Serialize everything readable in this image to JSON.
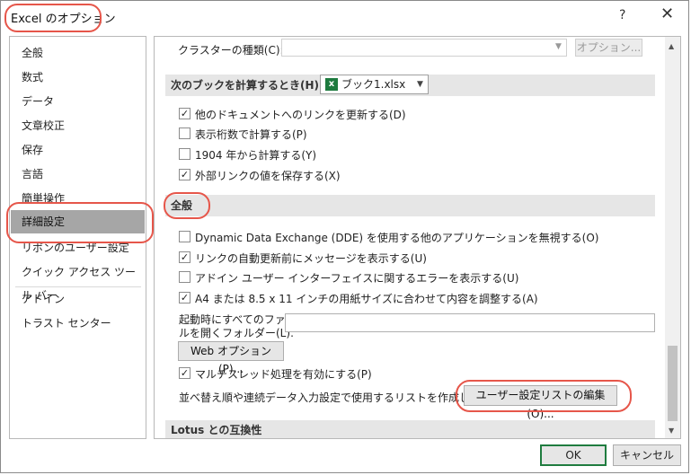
{
  "window": {
    "title": "Excel のオプション",
    "help": "?",
    "close": "✕"
  },
  "nav": {
    "items": [
      {
        "label": "全般"
      },
      {
        "label": "数式"
      },
      {
        "label": "データ"
      },
      {
        "label": "文章校正"
      },
      {
        "label": "保存"
      },
      {
        "label": "言語"
      },
      {
        "label": "簡単操作"
      },
      {
        "label": "詳細設定"
      },
      {
        "label": "リボンのユーザー設定"
      },
      {
        "label": "クイック アクセス ツール バー"
      },
      {
        "label": "アドイン"
      },
      {
        "label": "トラスト センター"
      }
    ],
    "selected": "詳細設定"
  },
  "cluster": {
    "label": "クラスターの種類(C):",
    "options_button": "オプション..."
  },
  "calc_section": {
    "header": "次のブックを計算するとき(H):",
    "workbook": "ブック1.xlsx",
    "options": [
      {
        "label": "他のドキュメントへのリンクを更新する(D)",
        "checked": "✓"
      },
      {
        "label": "表示桁数で計算する(P)",
        "checked": ""
      },
      {
        "label": "1904 年から計算する(Y)",
        "checked": ""
      },
      {
        "label": "外部リンクの値を保存する(X)",
        "checked": "✓"
      }
    ]
  },
  "general_section": {
    "header": "全般",
    "options": [
      {
        "label": "Dynamic Data Exchange (DDE) を使用する他のアプリケーションを無視する(O)",
        "checked": ""
      },
      {
        "label": "リンクの自動更新前にメッセージを表示する(U)",
        "checked": "✓"
      },
      {
        "label": "アドイン ユーザー インターフェイスに関するエラーを表示する(U)",
        "checked": ""
      },
      {
        "label": "A4 または 8.5 x 11 インチの用紙サイズに合わせて内容を調整する(A)",
        "checked": "✓"
      }
    ],
    "startup_label_1": "起動時にすべてのファイ",
    "startup_label_2": "ルを開くフォルダー(L):",
    "startup_value": "",
    "web_options_button": "Web オプション(P)...",
    "multithread": {
      "label": "マルチスレッド処理を有効にする(P)",
      "checked": "✓"
    },
    "sort_list_label": "並べ替え順や連続データ入力設定で使用するリストを作成します:",
    "edit_lists_button": "ユーザー設定リストの編集(O)..."
  },
  "lotus_section": {
    "header": "Lotus との互換性"
  },
  "footer": {
    "ok": "OK",
    "cancel": "キャンセル"
  },
  "colors": {
    "annotation": "#e6564a",
    "selected_nav": "#a6a6a6",
    "ok_border": "#1f7c3f",
    "excel_green": "#1d7a3e"
  }
}
